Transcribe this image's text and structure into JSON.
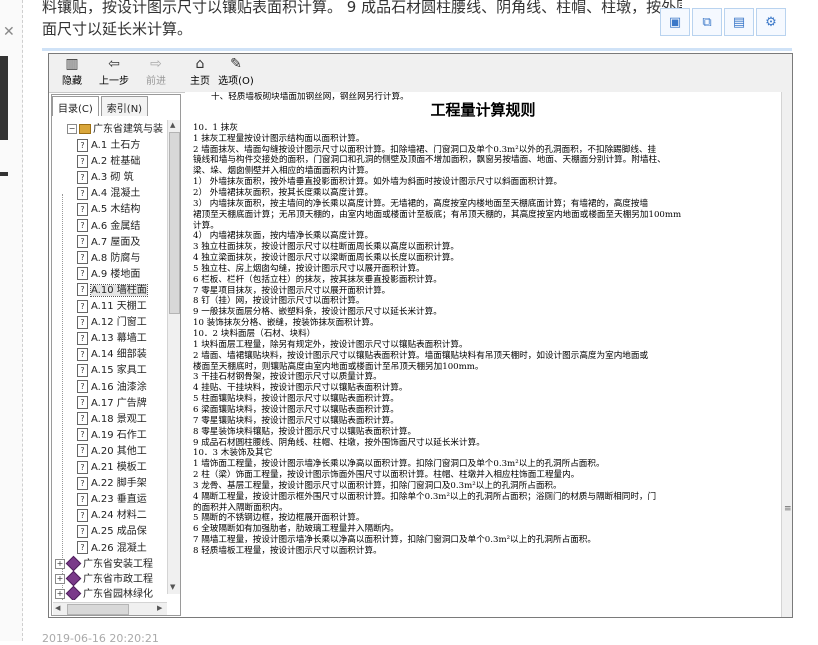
{
  "page": {
    "header_lines": [
      "料镶贴，按设计图示尺寸以镶贴表面积计算。 9 成品石材圆柱腰线、阴角线、柱帽、柱墩，按外围饰",
      "面尺寸以延长米计算。"
    ],
    "footer_date": "2019-06-16 20:20:21"
  },
  "floating_toolbar": [
    {
      "icon": "save-icon",
      "glyph": "▣"
    },
    {
      "icon": "copy-icon",
      "glyph": "⧉"
    },
    {
      "icon": "screenshot-icon",
      "glyph": "▤"
    },
    {
      "icon": "gear-icon",
      "glyph": "⚙"
    }
  ],
  "toolbar": {
    "buttons": [
      {
        "label": "隐藏",
        "icon": "hide-pane-icon",
        "glyph": "▥"
      },
      {
        "label": "上一步",
        "icon": "back-arrow-icon",
        "glyph": "⇦"
      },
      {
        "label": "前进",
        "icon": "forward-arrow-icon",
        "glyph": "⇨"
      },
      {
        "label": "主页",
        "icon": "home-icon",
        "glyph": "⌂"
      },
      {
        "label": "选项(O)",
        "icon": "options-icon",
        "glyph": "✎"
      }
    ]
  },
  "nav": {
    "tabs": [
      "目录(C)",
      "索引(N)"
    ],
    "root": "广东省建筑与装",
    "items": [
      "A.1  土石方",
      "A.2  桩基础",
      "A.3  砌  筑",
      "A.4  混凝土",
      "A.5  木结构",
      "A.6  金属结",
      "A.7  屋面及",
      "A.8  防腐与",
      "A.9  楼地面",
      "A.10  墙柱面",
      "A.11  天棚工",
      "A.12  门窗工",
      "A.13  幕墙工",
      "A.14  细部装",
      "A.15  家具工",
      "A.16  油漆涂",
      "A.17  广告牌",
      "A.18  景观工",
      "A.19  石作工",
      "A.20  其他工",
      "A.21  模板工",
      "A.22  脚手架",
      "A.23  垂直运",
      "A.24  材料二",
      "A.25  成品保",
      "A.26  混凝土"
    ],
    "selected_index": 9,
    "books": [
      "广东省安装工程",
      "广东省市政工程",
      "广东省园林绿化"
    ]
  },
  "content": {
    "title": "工程量计算规则",
    "lines": [
      "十、轻质墙板砌块墙面加钢丝网，钢丝网另行计算。",
      "10．1  抹灰",
      "   1  抹灰工程量按设计图示结构面以面积计算。",
      "   2  墙面抹灰、墙面勾缝按设计图示尺寸以面积计算。扣除墙裙、门窗洞口及单个0.3m²以外的孔洞面积，不扣除踢脚线、挂",
      "镜线和墙与构件交接处的面积，门窗洞口和孔洞的侧壁及顶面不增加面积，飘窗另按墙面、地面、天棚面分别计算。附墙柱、",
      "梁、垛、烟囱侧壁并入相应的墙面面积内计算。",
      "     1）  外墙抹灰面积，按外墙垂直投影面积计算。如外墙为斜面时按设计图示尺寸以斜面面积计算。",
      "     2）  外墙裙抹灰面积，按其长度乘以高度计算。",
      "     3）  内墙抹灰面积，按主墙间的净长乘以高度计算。无墙裙的，高度按室内楼地面至天棚底面计算；有墙裙的，高度按墙",
      "裙顶至天棚底面计算；无吊顶天棚的，由室内地面或楼面计至板底；有吊顶天棚的，其高度按室内地面或楼面至天棚另加100mm",
      "计算。",
      "     4）  内墙裙抹灰面，按内墙净长乘以高度计算。",
      "   3  独立柱面抹灰，按设计图示尺寸以柱断面周长乘以高度以面积计算。",
      "   4  独立梁面抹灰，按设计图示尺寸以梁断面周长乘以长度以面积计算。",
      "   5  独立柱、房上烟囱勾缝，按设计图示尺寸以展开面积计算。",
      "   6  栏板、栏杆（包括立柱）的抹灰，按其抹灰垂直投影面积计算。",
      "   7  零星项目抹灰，按设计图示尺寸以展开面积计算。",
      "   8  钉（挂）网，按设计图示尺寸以面积计算。",
      "   9  一般抹灰面层分格、嵌塑料条，按设计图示尺寸以延长米计算。",
      "   10  装饰抹灰分格、嵌缝，按装饰抹灰面积计算。",
      "10．2  块料面层（石材、块料）",
      "   1  块料面层工程量，除另有规定外，按设计图示尺寸以镶贴表面积计算。",
      "   2  墙面、墙裙镶贴块料，按设计图示尺寸以镶贴表面积计算。墙面镶贴块料有吊顶天棚时，如设计图示高度为室内地面或",
      "楼面至天棚底时，则镶贴高度由室内地面或楼面计至吊顶天棚另加100mm。",
      "   3  干挂石材钢骨架，按设计图示尺寸以质量计算。",
      "   4  挂贴、干挂块料，按设计图示尺寸以镶贴表面积计算。",
      "   5  柱面镶贴块料，按设计图示尺寸以镶贴表面积计算。",
      "   6  梁面镶贴块料，按设计图示尺寸以镶贴表面积计算。",
      "   7  零星镶贴块料，按设计图示尺寸以镶贴表面积计算。",
      "   8  零星装饰块料镶贴，按设计图示尺寸以镶贴表面积计算。",
      "   9  成品石材圆柱腰线、阴角线、柱帽、柱墩，按外围饰面尺寸以延长米计算。",
      "10．3  木装饰及其它",
      "   1  墙饰面工程量，按设计图示墙净长乘以净高以面积计算。扣除门窗洞口及单个0.3m²以上的孔洞所占面积。",
      "   2  柱（梁）饰面工程量，按设计图示饰面外围尺寸以面积计算。柱帽、柱墩并入相应柱饰面工程量内。",
      "   3  龙骨、基层工程量，按设计图示尺寸以面积计算，扣除门窗洞口及0.3m²以上的孔洞所占面积。",
      "   4  隔断工程量，按设计图示框外围尺寸以面积计算。扣除单个0.3m²以上的孔洞所占面积；浴厕门的材质与隔断相同时，门",
      "的面积并入隔断面积内。",
      "   5  隔断的不锈钢边框，按边框展开面积计算。",
      "   6  全玻隔断如有加强肋者，肋玻璃工程量并入隔断内。",
      "   7  隔墙工程量，按设计图示墙净长乘以净高以面积计算，扣除门窗洞口及单个0.3m²以上的孔洞所占面积。",
      "8  轻质墙板工程量，按设计图示尺寸以面积计算。"
    ]
  }
}
